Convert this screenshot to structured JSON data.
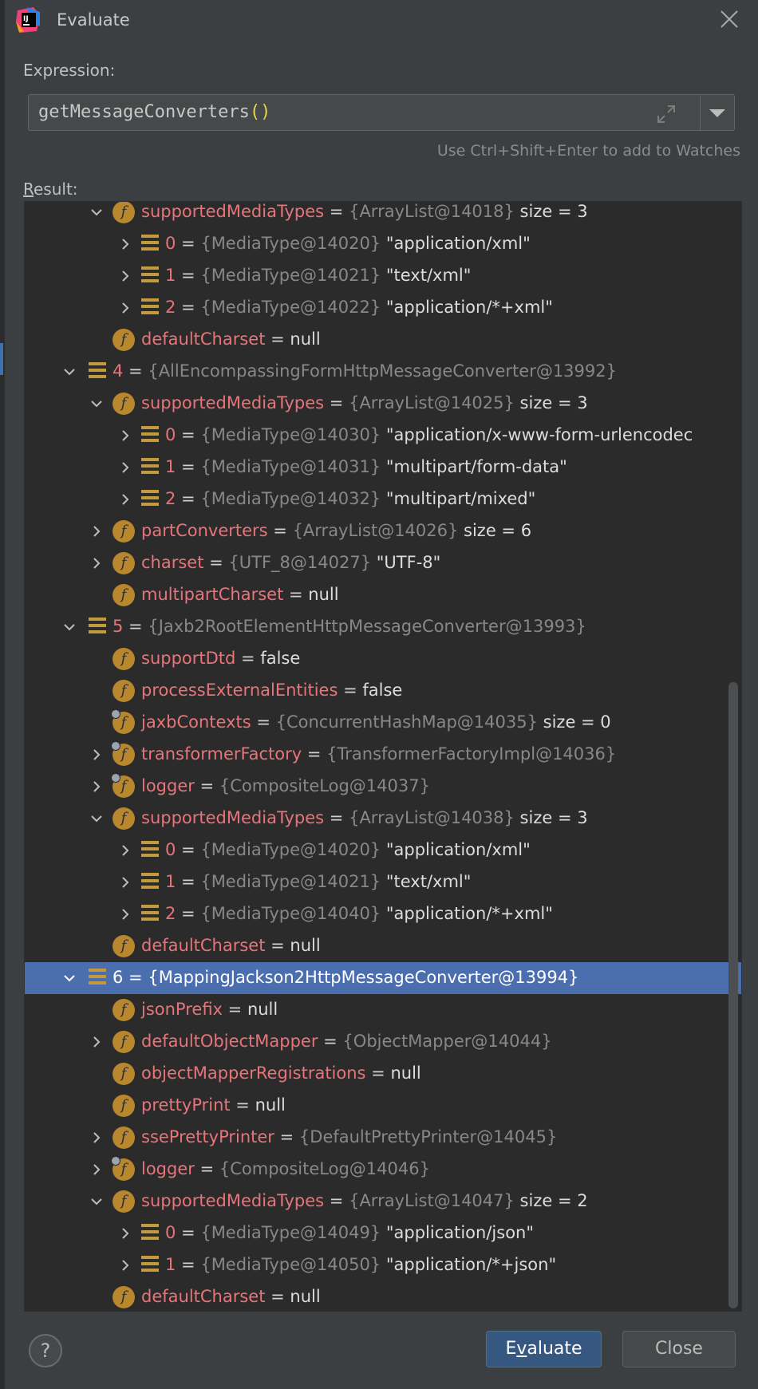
{
  "dialog": {
    "title": "Evaluate",
    "expression_label": "Expression:",
    "expression_value": "getMessageConverters",
    "expression_parens": "()",
    "hint": "Use Ctrl+Shift+Enter to add to Watches",
    "result_label_mnemonic": "R",
    "result_label_rest": "esult:",
    "help_label": "?",
    "evaluate_label_pre": "E",
    "evaluate_label_mnemonic": "v",
    "evaluate_label_post": "aluate",
    "close_label": "Close"
  },
  "colors": {
    "background": "#3c3f41",
    "tree_background": "#2b2b2b",
    "field_name": "#e8747a",
    "type_text": "#888888",
    "selection": "#4b6eaf",
    "field_icon": "#b8872e",
    "primary_button": "#365880"
  },
  "result_rows": [
    {
      "chevron": "open",
      "icon": "field",
      "name": "supportedMediaTypes",
      "eq": " = ",
      "type": "{ArrayList@14018}",
      "value": "  size = 3",
      "level": 2,
      "selected": false
    },
    {
      "chevron": "closed",
      "icon": "array",
      "name": "0",
      "eq": " = ",
      "type": "{MediaType@14020}",
      "value": " \"application/xml\"",
      "level": 3,
      "selected": false
    },
    {
      "chevron": "closed",
      "icon": "array",
      "name": "1",
      "eq": " = ",
      "type": "{MediaType@14021}",
      "value": " \"text/xml\"",
      "level": 3,
      "selected": false
    },
    {
      "chevron": "closed",
      "icon": "array",
      "name": "2",
      "eq": " = ",
      "type": "{MediaType@14022}",
      "value": " \"application/*+xml\"",
      "level": 3,
      "selected": false
    },
    {
      "chevron": "none",
      "icon": "field",
      "name": "defaultCharset",
      "eq": " = ",
      "type": "",
      "value": "null",
      "level": 2,
      "selected": false
    },
    {
      "chevron": "open",
      "icon": "array",
      "name": "4",
      "eq": " = ",
      "type": "{AllEncompassingFormHttpMessageConverter@13992}",
      "value": "",
      "level": 1,
      "selected": false
    },
    {
      "chevron": "open",
      "icon": "field",
      "name": "supportedMediaTypes",
      "eq": " = ",
      "type": "{ArrayList@14025}",
      "value": "  size = 3",
      "level": 2,
      "selected": false
    },
    {
      "chevron": "closed",
      "icon": "array",
      "name": "0",
      "eq": " = ",
      "type": "{MediaType@14030}",
      "value": " \"application/x-www-form-urlencodec",
      "level": 3,
      "selected": false
    },
    {
      "chevron": "closed",
      "icon": "array",
      "name": "1",
      "eq": " = ",
      "type": "{MediaType@14031}",
      "value": " \"multipart/form-data\"",
      "level": 3,
      "selected": false
    },
    {
      "chevron": "closed",
      "icon": "array",
      "name": "2",
      "eq": " = ",
      "type": "{MediaType@14032}",
      "value": " \"multipart/mixed\"",
      "level": 3,
      "selected": false
    },
    {
      "chevron": "closed",
      "icon": "field",
      "name": "partConverters",
      "eq": " = ",
      "type": "{ArrayList@14026}",
      "value": "  size = 6",
      "level": 2,
      "selected": false
    },
    {
      "chevron": "closed",
      "icon": "field",
      "name": "charset",
      "eq": " = ",
      "type": "{UTF_8@14027}",
      "value": " \"UTF-8\"",
      "level": 2,
      "selected": false
    },
    {
      "chevron": "none",
      "icon": "field",
      "name": "multipartCharset",
      "eq": " = ",
      "type": "",
      "value": "null",
      "level": 2,
      "selected": false
    },
    {
      "chevron": "open",
      "icon": "array",
      "name": "5",
      "eq": " = ",
      "type": "{Jaxb2RootElementHttpMessageConverter@13993}",
      "value": "",
      "level": 1,
      "selected": false
    },
    {
      "chevron": "none",
      "icon": "field",
      "name": "supportDtd",
      "eq": " = ",
      "type": "",
      "value": "false",
      "level": 2,
      "selected": false
    },
    {
      "chevron": "none",
      "icon": "field",
      "name": "processExternalEntities",
      "eq": " = ",
      "type": "",
      "value": "false",
      "level": 2,
      "selected": false
    },
    {
      "chevron": "none",
      "icon": "field-locked",
      "name": "jaxbContexts",
      "eq": " = ",
      "type": "{ConcurrentHashMap@14035}",
      "value": "  size = 0",
      "level": 2,
      "selected": false
    },
    {
      "chevron": "closed",
      "icon": "field-locked",
      "name": "transformerFactory",
      "eq": " = ",
      "type": "{TransformerFactoryImpl@14036}",
      "value": "",
      "level": 2,
      "selected": false
    },
    {
      "chevron": "closed",
      "icon": "field-locked",
      "name": "logger",
      "eq": " = ",
      "type": "{CompositeLog@14037}",
      "value": "",
      "level": 2,
      "selected": false
    },
    {
      "chevron": "open",
      "icon": "field",
      "name": "supportedMediaTypes",
      "eq": " = ",
      "type": "{ArrayList@14038}",
      "value": "  size = 3",
      "level": 2,
      "selected": false
    },
    {
      "chevron": "closed",
      "icon": "array",
      "name": "0",
      "eq": " = ",
      "type": "{MediaType@14020}",
      "value": " \"application/xml\"",
      "level": 3,
      "selected": false
    },
    {
      "chevron": "closed",
      "icon": "array",
      "name": "1",
      "eq": " = ",
      "type": "{MediaType@14021}",
      "value": " \"text/xml\"",
      "level": 3,
      "selected": false
    },
    {
      "chevron": "closed",
      "icon": "array",
      "name": "2",
      "eq": " = ",
      "type": "{MediaType@14040}",
      "value": " \"application/*+xml\"",
      "level": 3,
      "selected": false
    },
    {
      "chevron": "none",
      "icon": "field",
      "name": "defaultCharset",
      "eq": " = ",
      "type": "",
      "value": "null",
      "level": 2,
      "selected": false
    },
    {
      "chevron": "open",
      "icon": "array",
      "name": "6",
      "eq": " = ",
      "type": "{MappingJackson2HttpMessageConverter@13994}",
      "value": "",
      "level": 1,
      "selected": true
    },
    {
      "chevron": "none",
      "icon": "field",
      "name": "jsonPrefix",
      "eq": " = ",
      "type": "",
      "value": "null",
      "level": 2,
      "selected": false
    },
    {
      "chevron": "closed",
      "icon": "field",
      "name": "defaultObjectMapper",
      "eq": " = ",
      "type": "{ObjectMapper@14044}",
      "value": "",
      "level": 2,
      "selected": false
    },
    {
      "chevron": "none",
      "icon": "field",
      "name": "objectMapperRegistrations",
      "eq": " = ",
      "type": "",
      "value": "null",
      "level": 2,
      "selected": false
    },
    {
      "chevron": "none",
      "icon": "field",
      "name": "prettyPrint",
      "eq": " = ",
      "type": "",
      "value": "null",
      "level": 2,
      "selected": false
    },
    {
      "chevron": "closed",
      "icon": "field",
      "name": "ssePrettyPrinter",
      "eq": " = ",
      "type": "{DefaultPrettyPrinter@14045}",
      "value": "",
      "level": 2,
      "selected": false
    },
    {
      "chevron": "closed",
      "icon": "field-locked",
      "name": "logger",
      "eq": " = ",
      "type": "{CompositeLog@14046}",
      "value": "",
      "level": 2,
      "selected": false
    },
    {
      "chevron": "open",
      "icon": "field",
      "name": "supportedMediaTypes",
      "eq": " = ",
      "type": "{ArrayList@14047}",
      "value": "  size = 2",
      "level": 2,
      "selected": false
    },
    {
      "chevron": "closed",
      "icon": "array",
      "name": "0",
      "eq": " = ",
      "type": "{MediaType@14049}",
      "value": " \"application/json\"",
      "level": 3,
      "selected": false
    },
    {
      "chevron": "closed",
      "icon": "array",
      "name": "1",
      "eq": " = ",
      "type": "{MediaType@14050}",
      "value": " \"application/*+json\"",
      "level": 3,
      "selected": false
    },
    {
      "chevron": "none",
      "icon": "field",
      "name": "defaultCharset",
      "eq": " = ",
      "type": "",
      "value": "null",
      "level": 2,
      "selected": false
    }
  ]
}
